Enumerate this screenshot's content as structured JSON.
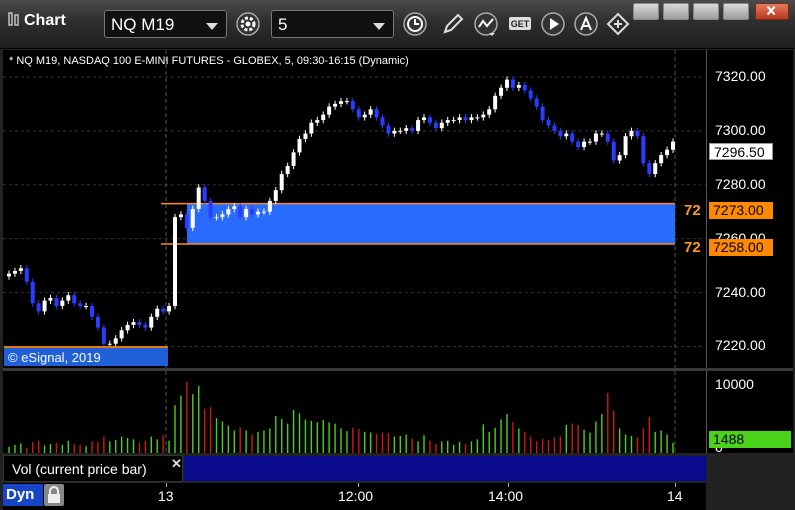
{
  "window": {
    "title": "Chart",
    "symbol": "NQ M19",
    "interval": "5",
    "controls": [
      "snap-window",
      "restore",
      "maximize",
      "close"
    ]
  },
  "chart": {
    "description": "* NQ M19, NASDAQ 100 E-MINI FUTURES - GLOBEX, 5, 09:30-16:15 (Dynamic)",
    "copyright": "© eSignal, 2019",
    "last_price": "7296.50",
    "band_upper": "7273.00",
    "band_lower": "7258.00",
    "band_upper_short": "72",
    "band_lower_short": "72",
    "volume_title": "Vol (current price bar)",
    "volume_last": "1488",
    "mode_button": "Dyn",
    "colors": {
      "band": "#2a6bff",
      "band_line": "#ff8c1a",
      "up": "#ffffff",
      "down": "#2a3cff",
      "vol_up": "#4bd21b",
      "vol_down": "#d01818"
    }
  },
  "chart_data": {
    "type": "candlestick",
    "title": "",
    "ylim": [
      7212,
      7330
    ],
    "y_ticks": [
      "7320.00",
      "7300.00",
      "7280.00",
      "7260.00",
      "7240.00",
      "7220.00"
    ],
    "volume_ticks": [
      "10000",
      "0"
    ],
    "volume_ylim": [
      0,
      12000
    ],
    "x_ticks": [
      "13",
      "12:00",
      "14:00",
      "14"
    ],
    "closes": [
      7247,
      7248,
      7249,
      7244,
      7236,
      7233,
      7237,
      7238,
      7235,
      7237,
      7239,
      7236,
      7235,
      7235,
      7231,
      7227,
      7221,
      7221,
      7223,
      7226,
      7228,
      7229,
      7228,
      7227,
      7231,
      7234,
      7233,
      7235,
      7268,
      7269,
      7264,
      7271,
      7279,
      7274,
      7268,
      7268,
      7269,
      7271,
      7272,
      7268,
      7271,
      7269,
      7270,
      7270,
      7274,
      7278,
      7284,
      7287,
      7292,
      7297,
      7299,
      7303,
      7304,
      7306,
      7309,
      7310,
      7311,
      7311,
      7308,
      7305,
      7306,
      7308,
      7305,
      7302,
      7299,
      7300,
      7300,
      7301,
      7300,
      7304,
      7305,
      7303,
      7301,
      7303,
      7304,
      7304,
      7305,
      7304,
      7305,
      7305,
      7306,
      7308,
      7313,
      7316,
      7319,
      7316,
      7317,
      7315,
      7312,
      7309,
      7304,
      7302,
      7300,
      7298,
      7299,
      7296,
      7294,
      7296,
      7296,
      7299,
      7299,
      7296,
      7289,
      7291,
      7298,
      7300,
      7298,
      7288,
      7284,
      7288,
      7291,
      7293,
      7296
    ],
    "volumes": [
      900,
      1200,
      1400,
      800,
      1600,
      1800,
      1100,
      1300,
      1500,
      1200,
      1800,
      1300,
      1200,
      1000,
      1700,
      1600,
      2400,
      1700,
      1900,
      2400,
      2200,
      2000,
      1500,
      1800,
      2400,
      2000,
      2600,
      1800,
      7000,
      8400,
      10400,
      8600,
      9800,
      6500,
      6700,
      5100,
      4600,
      4000,
      3300,
      3700,
      3300,
      2700,
      3100,
      3300,
      3600,
      5400,
      5000,
      4300,
      6300,
      5800,
      4900,
      4700,
      4500,
      4800,
      4500,
      4300,
      3600,
      3200,
      3700,
      3500,
      3100,
      3000,
      2800,
      3000,
      2900,
      2400,
      2500,
      2700,
      2100,
      1700,
      2600,
      1800,
      1300,
      1700,
      1800,
      1200,
      1600,
      1300,
      1700,
      2000,
      4200,
      3100,
      3700,
      4900,
      5700,
      4500,
      3600,
      3100,
      2400,
      1700,
      2100,
      1900,
      2300,
      2400,
      4100,
      4300,
      4100,
      3400,
      3000,
      4600,
      5700,
      8800,
      6200,
      3600,
      2700,
      2500,
      2300,
      3600,
      5300,
      3100,
      3300,
      2700,
      1488
    ]
  }
}
